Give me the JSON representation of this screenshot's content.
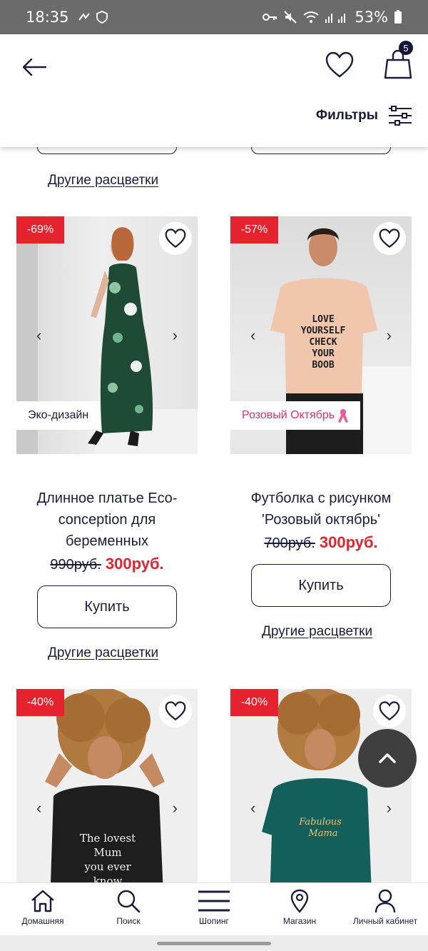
{
  "status_bar": {
    "time": "18:35",
    "battery": "53%"
  },
  "header": {
    "filters_label": "Фильтры",
    "cart_count": "5"
  },
  "links": {
    "other_colors": "Другие расцветки"
  },
  "products": [
    {
      "discount": "-69%",
      "tag": "Эко-дизайн",
      "title": "Длинное платье Eco-conception для беременных",
      "old_price": "990руб.",
      "new_price": "300руб.",
      "buy": "Купить",
      "other_colors": "Другие расцветки",
      "arrow_left": "‹",
      "arrow_right": "›"
    },
    {
      "discount": "-57%",
      "tag": "Розовый Октябрь",
      "title": "Футболка с рисунком 'Розовый октябрь'",
      "old_price": "700руб.",
      "new_price": "300руб.",
      "buy": "Купить",
      "other_colors": "Другие расцветки",
      "arrow_left": "‹",
      "arrow_right": "›"
    },
    {
      "discount": "-40%",
      "arrow_left": "‹",
      "arrow_right": "›"
    },
    {
      "discount": "-40%",
      "arrow_left": "‹",
      "arrow_right": "›"
    }
  ],
  "bottom_nav": [
    {
      "label": "Домашняя",
      "icon": "home-icon"
    },
    {
      "label": "Поиск",
      "icon": "search-icon"
    },
    {
      "label": "Шопинг",
      "icon": "menu-icon"
    },
    {
      "label": "Магазин",
      "icon": "location-icon"
    },
    {
      "label": "Личный кабинет",
      "icon": "user-icon"
    }
  ],
  "colors": {
    "accent_red": "#e4232f",
    "navy": "#1c1c3a",
    "pink": "#d6336c"
  }
}
